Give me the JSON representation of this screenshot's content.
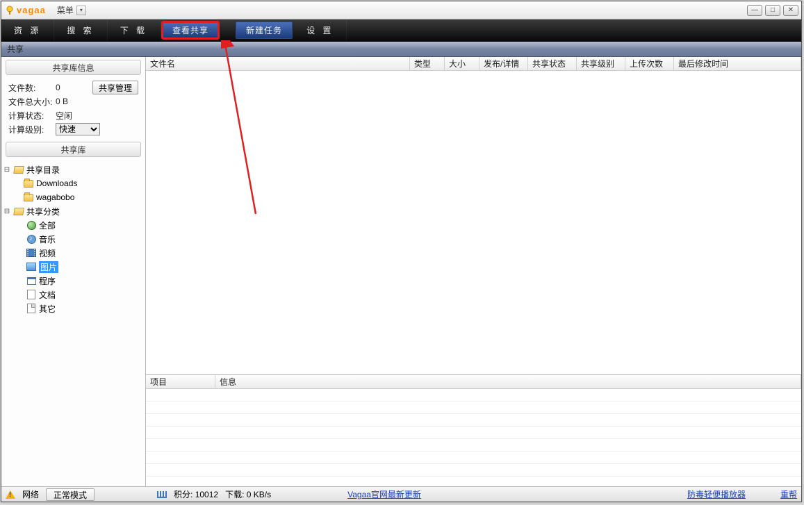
{
  "titlebar": {
    "brand": "vagaa",
    "menu": "菜单"
  },
  "toolbar": {
    "resource": "资 源",
    "search": "搜 索",
    "download": "下 载",
    "view_share": "查看共享",
    "new_task": "新建任务",
    "settings": "设 置"
  },
  "section": {
    "share": "共享"
  },
  "sidebar": {
    "panel_info": "共享库信息",
    "file_count_label": "文件数:",
    "file_count": "0",
    "manage_btn": "共享管理",
    "total_size_label": "文件总大小:",
    "total_size": "0 B",
    "calc_status_label": "计算状态:",
    "calc_status": "空闲",
    "calc_level_label": "计算级别:",
    "calc_level": "快速",
    "panel_lib": "共享库",
    "tree": {
      "share_dir": "共享目录",
      "downloads": "Downloads",
      "wagabobo": "wagabobo",
      "share_cat": "共享分类",
      "all": "全部",
      "music": "音乐",
      "video": "视频",
      "image": "图片",
      "program": "程序",
      "doc": "文档",
      "other": "其它"
    }
  },
  "columns": {
    "filename": "文件名",
    "type": "类型",
    "size": "大小",
    "pub_detail": "发布/详情",
    "share_status": "共享状态",
    "share_level": "共享级别",
    "upload_count": "上传次数",
    "last_modified": "最后修改时间"
  },
  "info_panel": {
    "item": "项目",
    "info": "信息"
  },
  "statusbar": {
    "network": "网络",
    "mode": "正常模式",
    "score": "积分: 10012",
    "download": "下载: 0 KB/s",
    "official_update": "Vagaa官网最新更新",
    "av_player": "防毒轻便播放器",
    "donate": "重帮"
  }
}
